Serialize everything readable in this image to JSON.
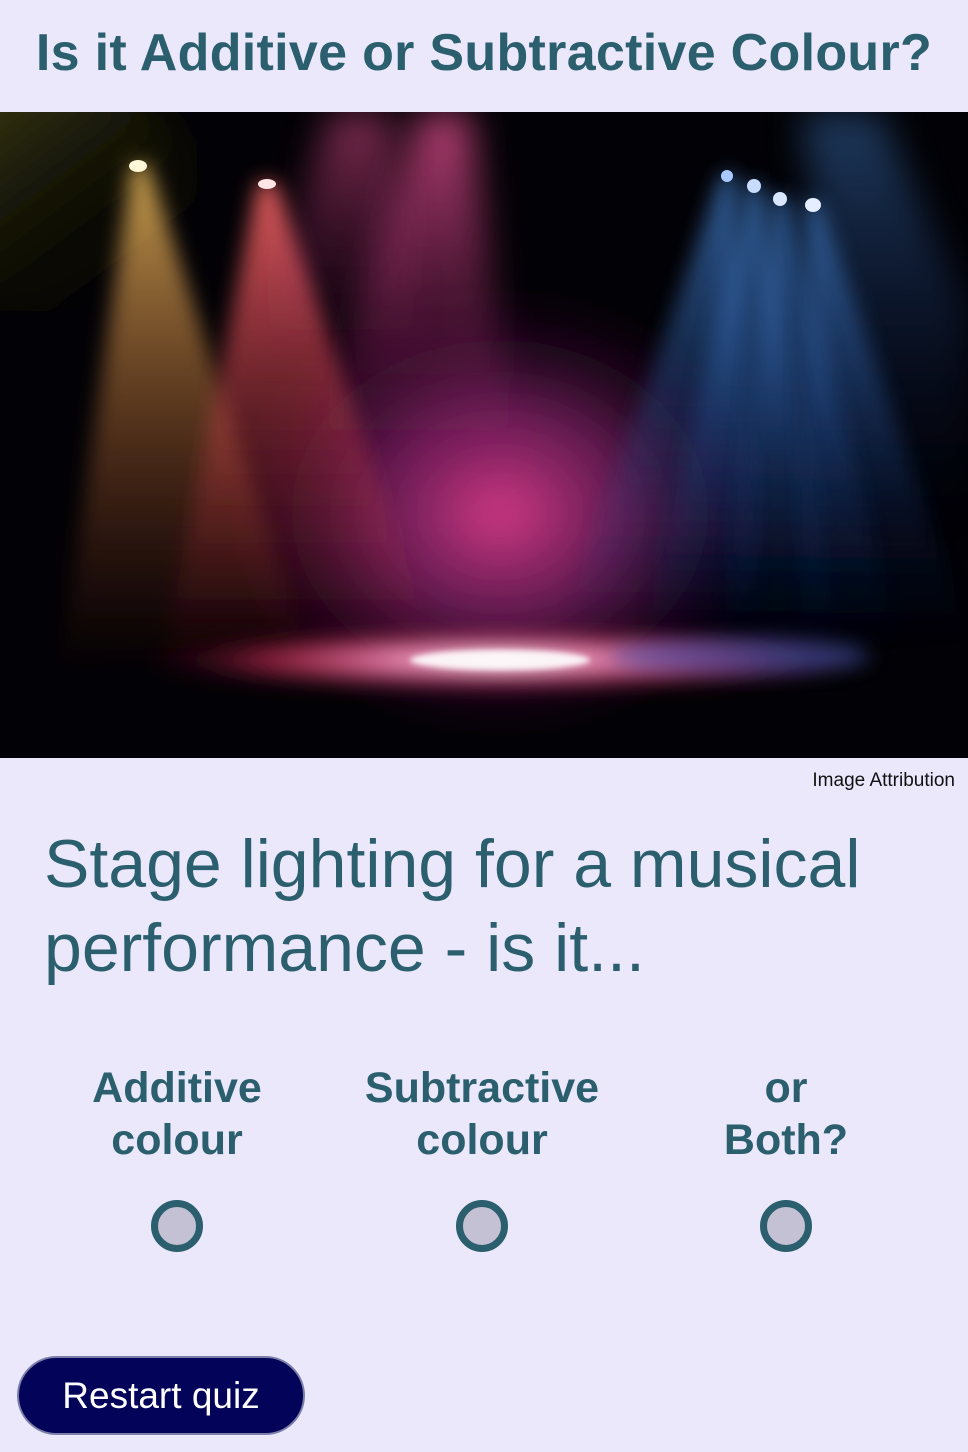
{
  "header": {
    "title": "Is it Additive or Subtractive Colour?"
  },
  "image": {
    "attribution_label": "Image Attribution"
  },
  "question": {
    "text": "Stage lighting for a musical performance - is it..."
  },
  "options": [
    {
      "label": "Additive\ncolour",
      "selected": false
    },
    {
      "label": "Subtractive\ncolour",
      "selected": false
    },
    {
      "label": "or\nBoth?",
      "selected": false
    }
  ],
  "footer": {
    "restart_label": "Restart quiz"
  },
  "colors": {
    "background": "#ebe8fc",
    "title_text": "#2b5f6e",
    "radio_fill": "#c3c1d3",
    "button_bg": "#03035a"
  }
}
